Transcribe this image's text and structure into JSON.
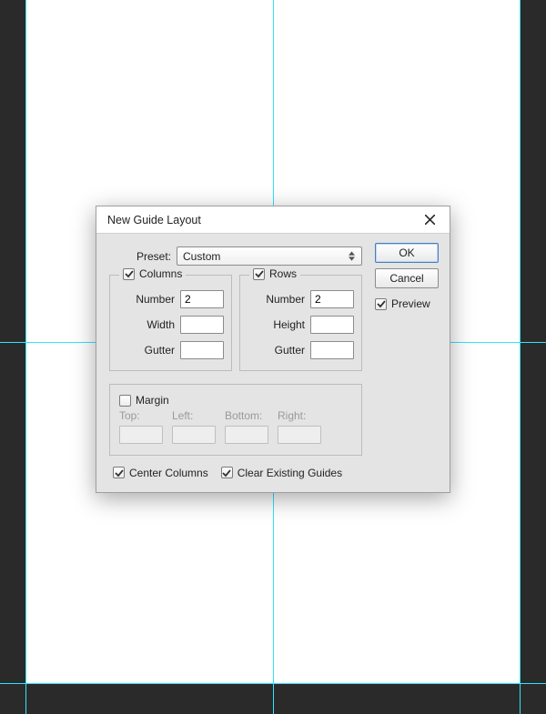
{
  "guides": {
    "v": [
      28,
      300,
      572
    ],
    "h": [
      376,
      752
    ]
  },
  "dialog": {
    "title": "New Guide Layout",
    "preset": {
      "label": "Preset:",
      "value": "Custom"
    },
    "columns": {
      "legend": "Columns",
      "checked": true,
      "number_label": "Number",
      "number_value": "2",
      "width_label": "Width",
      "width_value": "",
      "gutter_label": "Gutter",
      "gutter_value": ""
    },
    "rows": {
      "legend": "Rows",
      "checked": true,
      "number_label": "Number",
      "number_value": "2",
      "height_label": "Height",
      "height_value": "",
      "gutter_label": "Gutter",
      "gutter_value": ""
    },
    "margin": {
      "legend": "Margin",
      "checked": false,
      "top_label": "Top:",
      "left_label": "Left:",
      "bottom_label": "Bottom:",
      "right_label": "Right:"
    },
    "center_columns": {
      "label": "Center Columns",
      "checked": true
    },
    "clear_existing": {
      "label": "Clear Existing Guides",
      "checked": true
    },
    "buttons": {
      "ok": "OK",
      "cancel": "Cancel"
    },
    "preview": {
      "label": "Preview",
      "checked": true
    }
  }
}
